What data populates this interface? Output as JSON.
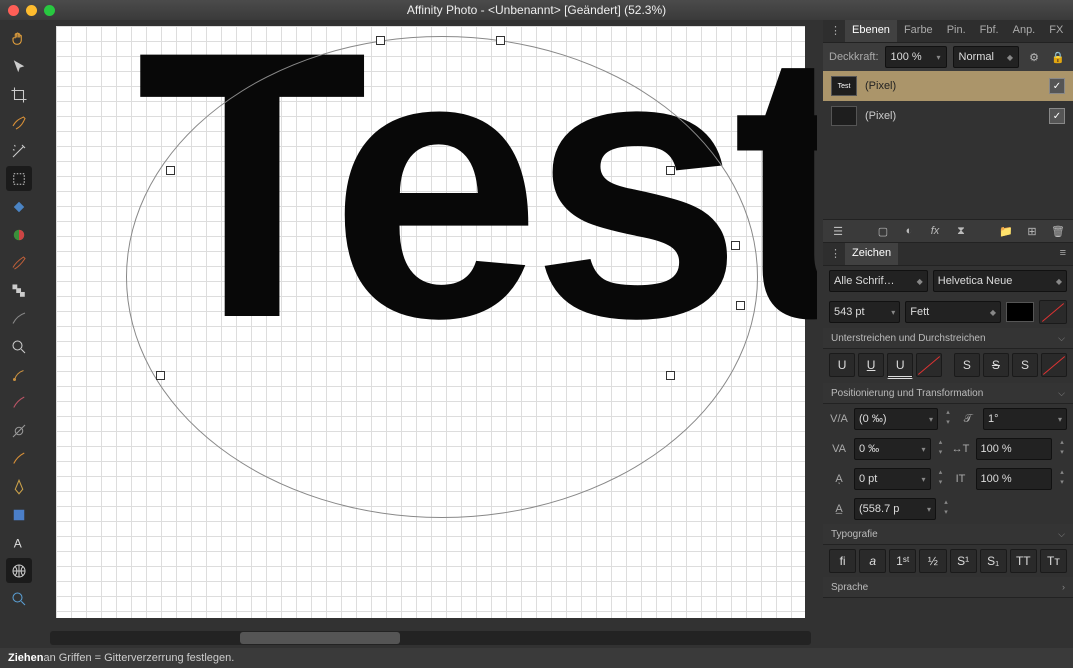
{
  "window": {
    "title": "Affinity Photo - <Unbenannt> [Geändert] (52.3%)"
  },
  "canvas": {
    "text": "Test"
  },
  "tabs_top": {
    "ebenen": "Ebenen",
    "farbe": "Farbe",
    "pin": "Pin.",
    "fbf": "Fbf.",
    "anp": "Anp.",
    "fx": "FX"
  },
  "opacity": {
    "label": "Deckkraft:",
    "value": "100 %",
    "blend": "Normal"
  },
  "layers": [
    {
      "thumb": "Test",
      "name": "(Pixel)",
      "sel": true
    },
    {
      "thumb": "",
      "name": "(Pixel)",
      "sel": false
    }
  ],
  "char_tab": "Zeichen",
  "font": {
    "collection": "Alle Schrif…",
    "family": "Helvetica Neue",
    "size": "543 pt",
    "weight": "Fett"
  },
  "sections": {
    "und": "Unterstreichen und Durchstreichen",
    "pos": "Positionierung und Transformation",
    "typo": "Typografie",
    "lang": "Sprache"
  },
  "und_btns": {
    "u1": "U",
    "u2": "U",
    "u3": "U",
    "s1": "S",
    "s2": "S",
    "s3": "S"
  },
  "pos": {
    "kerning": "(0 ‰)",
    "tracking": "0 ‰",
    "baseline": "0 pt",
    "leading": "(558.7 p",
    "shear": "1°",
    "hscale": "100 %",
    "vscale": "100 %"
  },
  "typo_btns": {
    "fi": "fi",
    "a": "a",
    "first": "1ˢᵗ",
    "half": "½",
    "sup": "S¹",
    "sub": "S₁",
    "tt": "TT",
    "tc": "Tᴛ"
  },
  "status": {
    "bold": "Ziehen",
    "rest": " an Griffen = Gitterverzerrung festlegen."
  }
}
